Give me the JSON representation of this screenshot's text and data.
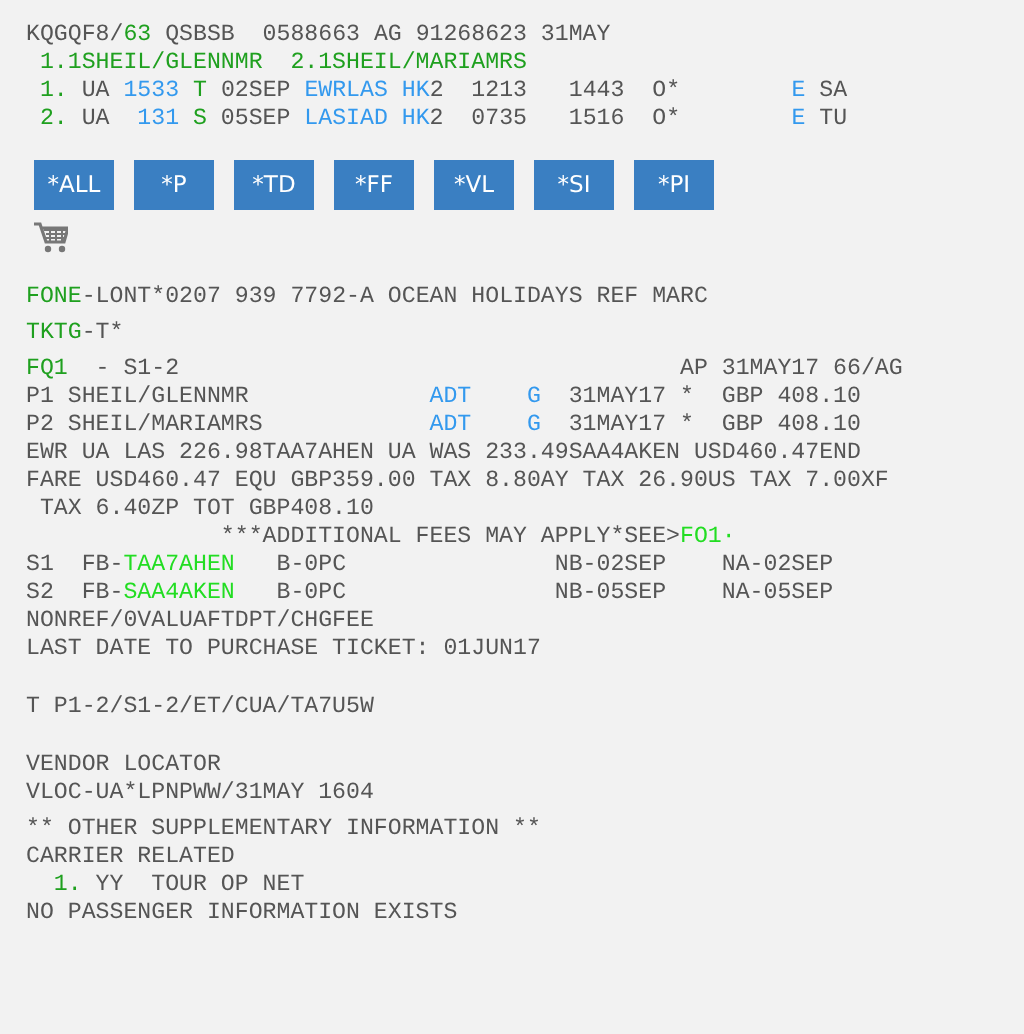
{
  "header": [
    {
      "segments": [
        {
          "text": "KQGQF8/"
        },
        {
          "text": "63",
          "color": "#1fa01f"
        },
        {
          "text": " QSBSB  0588663 AG 91268623 31MAY"
        }
      ]
    },
    {
      "segments": [
        {
          "text": " 1.1SHEIL/GLENNMR  2.1SHEIL/MARIAMRS",
          "color": "#1fa01f"
        }
      ]
    },
    {
      "segments": [
        {
          "text": " 1.",
          "color": "#1fa01f"
        },
        {
          "text": " UA "
        },
        {
          "text": "1533",
          "color": "#3399ee"
        },
        {
          "text": " T",
          "color": "#1fa01f"
        },
        {
          "text": " 02SEP "
        },
        {
          "text": "EWRLAS HK",
          "color": "#3399ee"
        },
        {
          "text": "2  1213   1443  O*        "
        },
        {
          "text": "E",
          "color": "#3399ee"
        },
        {
          "text": " SA"
        }
      ]
    },
    {
      "segments": [
        {
          "text": " 2.",
          "color": "#1fa01f"
        },
        {
          "text": " UA  "
        },
        {
          "text": "131",
          "color": "#3399ee"
        },
        {
          "text": " S",
          "color": "#1fa01f"
        },
        {
          "text": " 05SEP "
        },
        {
          "text": "LASIAD HK",
          "color": "#3399ee"
        },
        {
          "text": "2  0735   1516  O*        "
        },
        {
          "text": "E",
          "color": "#3399ee"
        },
        {
          "text": " TU"
        }
      ]
    }
  ],
  "buttons": [
    "*ALL",
    "*P",
    "*TD",
    "*FF",
    "*VL",
    "*SI",
    "*PI"
  ],
  "blocks": [
    {
      "lines": [
        {
          "segments": [
            {
              "text": "FONE",
              "color": "#1fa01f"
            },
            {
              "text": "-LONT*0207 939 7792-A OCEAN HOLIDAYS REF MARC"
            }
          ]
        }
      ]
    },
    {
      "lines": [
        {
          "segments": [
            {
              "text": "TKTG",
              "color": "#1fa01f"
            },
            {
              "text": "-T*"
            }
          ]
        }
      ]
    },
    {
      "lines": [
        {
          "segments": [
            {
              "text": "FQ1",
              "color": "#1fa01f"
            },
            {
              "text": "  - S1-2                                    AP 31MAY17 66/AG"
            }
          ]
        },
        {
          "segments": [
            {
              "text": "P1 SHEIL/GLENNMR             "
            },
            {
              "text": "ADT    G",
              "color": "#3399ee"
            },
            {
              "text": "  31MAY17 *  GBP 408.10"
            }
          ]
        },
        {
          "segments": [
            {
              "text": "P2 SHEIL/MARIAMRS            "
            },
            {
              "text": "ADT    G",
              "color": "#3399ee"
            },
            {
              "text": "  31MAY17 *  GBP 408.10"
            }
          ]
        },
        {
          "segments": [
            {
              "text": "EWR UA LAS 226.98TAA7AHEN UA WAS 233.49SAA4AKEN USD460.47END"
            }
          ]
        },
        {
          "segments": [
            {
              "text": "FARE USD460.47 EQU GBP359.00 TAX 8.80AY TAX 26.90US TAX 7.00XF"
            }
          ]
        },
        {
          "segments": [
            {
              "text": " TAX 6.40ZP TOT GBP408.10"
            }
          ]
        },
        {
          "segments": [
            {
              "text": "              ***ADDITIONAL FEES MAY APPLY*SEE>"
            },
            {
              "text": "FO1·",
              "color": "#22dd22"
            }
          ]
        },
        {
          "segments": [
            {
              "text": "S1  FB-"
            },
            {
              "text": "TAA7AHEN",
              "color": "#22dd22"
            },
            {
              "text": "   B-0PC               NB-02SEP    NA-02SEP"
            }
          ]
        },
        {
          "segments": [
            {
              "text": "S2  FB-"
            },
            {
              "text": "SAA4AKEN",
              "color": "#22dd22"
            },
            {
              "text": "   B-0PC               NB-05SEP    NA-05SEP"
            }
          ]
        },
        {
          "segments": [
            {
              "text": "NONREF/0VALUAFTDPT/CHGFEE"
            }
          ]
        },
        {
          "segments": [
            {
              "text": "LAST DATE TO PURCHASE TICKET: 01JUN17"
            }
          ]
        }
      ]
    },
    {
      "lines": [
        {
          "segments": [
            {
              "text": "T P1-2/S1-2/ET/CUA/TA7U5W"
            }
          ]
        }
      ]
    },
    {
      "lines": [
        {
          "segments": [
            {
              "text": "VENDOR LOCATOR"
            }
          ]
        },
        {
          "segments": [
            {
              "text": "VLOC-UA*LPNPWW/31MAY 1604"
            }
          ]
        }
      ]
    },
    {
      "lines": [
        {
          "segments": [
            {
              "text": "** OTHER SUPPLEMENTARY INFORMATION **"
            }
          ]
        },
        {
          "segments": [
            {
              "text": "CARRIER RELATED"
            }
          ]
        },
        {
          "segments": [
            {
              "text": "  1.",
              "color": "#1fa01f"
            },
            {
              "text": " YY  TOUR OP NET"
            }
          ]
        },
        {
          "segments": [
            {
              "text": "NO PASSENGER INFORMATION EXISTS"
            }
          ]
        }
      ]
    }
  ]
}
